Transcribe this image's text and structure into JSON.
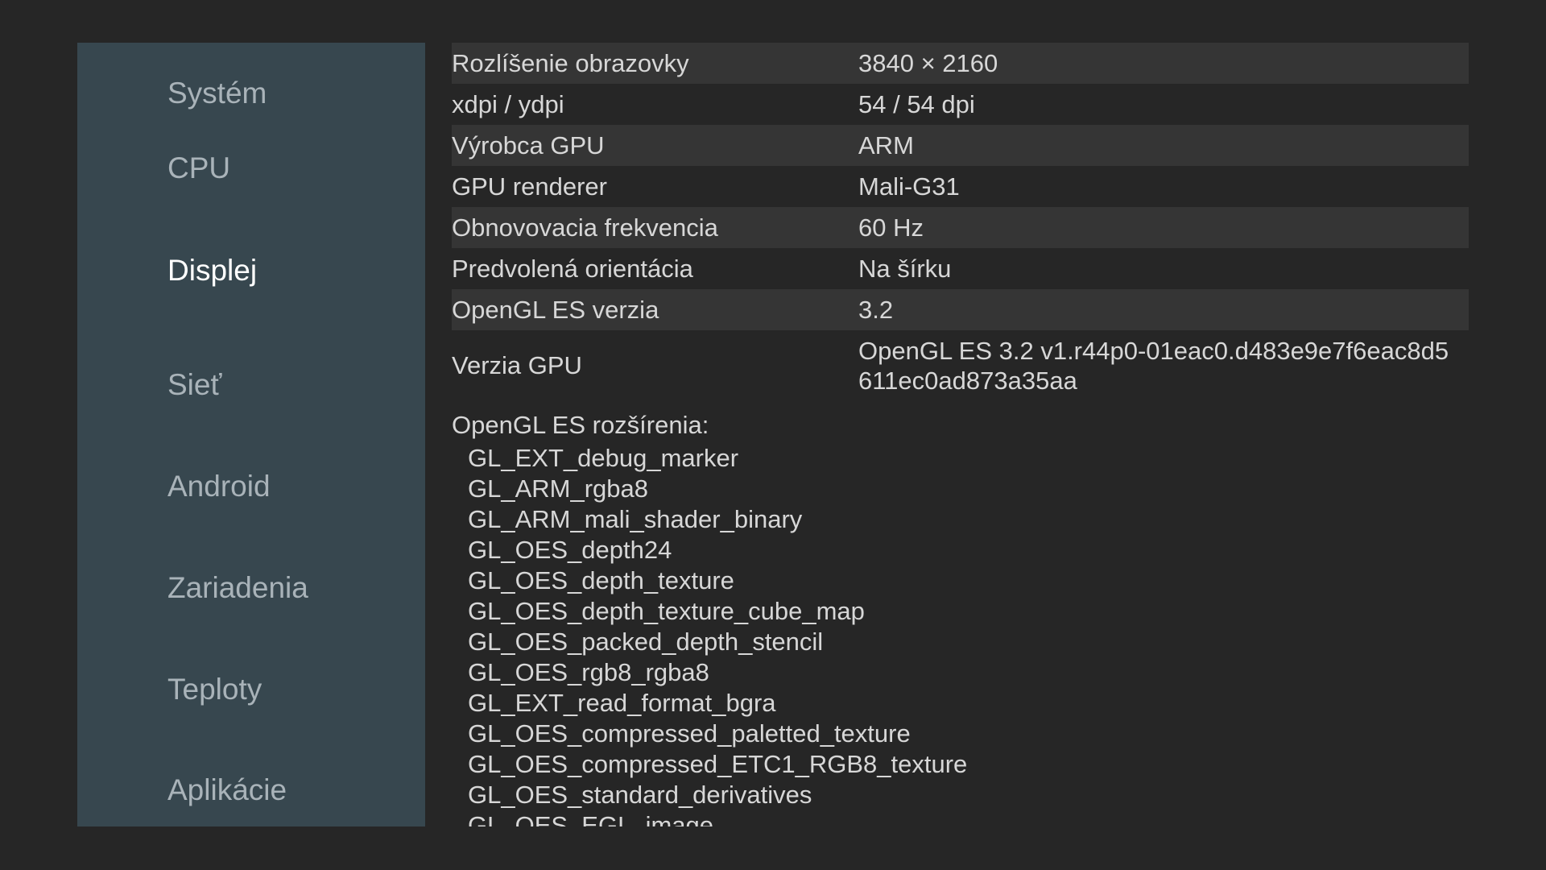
{
  "sidebar": {
    "items": [
      {
        "label": "Systém"
      },
      {
        "label": "CPU"
      },
      {
        "label": "Displej"
      },
      {
        "label": "Sieť"
      },
      {
        "label": "Android"
      },
      {
        "label": "Zariadenia"
      },
      {
        "label": "Teploty"
      },
      {
        "label": "Aplikácie"
      }
    ],
    "active": "Displej"
  },
  "display": {
    "rows": [
      {
        "label": "Rozlíšenie obrazovky",
        "value": "3840 × 2160"
      },
      {
        "label": "xdpi / ydpi",
        "value": "54 / 54 dpi"
      },
      {
        "label": "Výrobca GPU",
        "value": "ARM"
      },
      {
        "label": "GPU renderer",
        "value": "Mali-G31"
      },
      {
        "label": "Obnovovacia frekvencia",
        "value": "60 Hz"
      },
      {
        "label": "Predvolená orientácia",
        "value": "Na šírku"
      },
      {
        "label": "OpenGL ES verzia",
        "value": "3.2"
      },
      {
        "label": "Verzia GPU",
        "value": "OpenGL ES 3.2 v1.r44p0-01eac0.d483e9e7f6eac8d5611ec0ad873a35aa"
      }
    ],
    "extensions_title": "OpenGL ES rozšírenia:",
    "extensions": [
      "GL_EXT_debug_marker",
      "GL_ARM_rgba8",
      "GL_ARM_mali_shader_binary",
      "GL_OES_depth24",
      "GL_OES_depth_texture",
      "GL_OES_depth_texture_cube_map",
      "GL_OES_packed_depth_stencil",
      "GL_OES_rgb8_rgba8",
      "GL_EXT_read_format_bgra",
      "GL_OES_compressed_paletted_texture",
      "GL_OES_compressed_ETC1_RGB8_texture",
      "GL_OES_standard_derivatives",
      "GL_OES_EGL_image"
    ]
  },
  "colors": {
    "background": "#262626",
    "sidebar": "#37474f",
    "row_shade": "#353535",
    "active_text": "#ffffff",
    "inactive_text": "#a9b3b9",
    "content_text": "#d7d7d7"
  }
}
